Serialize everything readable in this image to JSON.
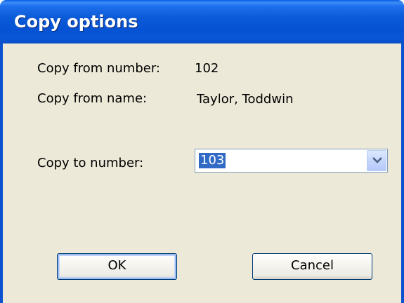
{
  "window": {
    "title": "Copy options"
  },
  "fields": {
    "copy_from_number_label": "Copy from number:",
    "copy_from_number_value": "102",
    "copy_from_name_label": "Copy from name:",
    "copy_from_name_value": "Taylor, Toddwin",
    "copy_to_number_label": "Copy to number:",
    "copy_to_number_value": "103"
  },
  "buttons": {
    "ok_label": "OK",
    "cancel_label": "Cancel"
  },
  "icons": {
    "dropdown": "chevron-down-icon"
  },
  "colors": {
    "titlebar": "#0a56d8",
    "dialog_background": "#ece9d8",
    "selection": "#316ac5"
  }
}
